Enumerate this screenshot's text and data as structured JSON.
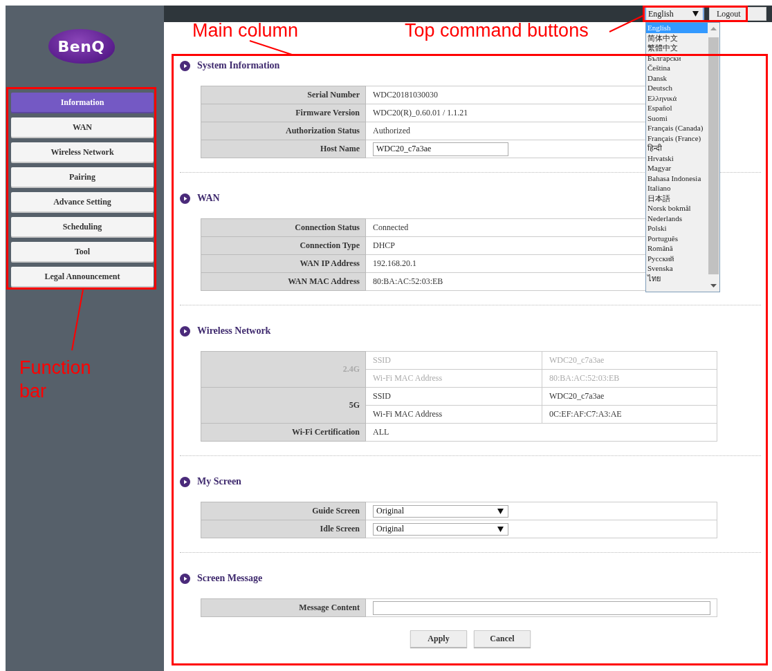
{
  "annotations": [
    {
      "kind": "label",
      "text": "Main column"
    },
    {
      "kind": "label",
      "text": "Top command buttons"
    },
    {
      "kind": "label",
      "text": "Function bar"
    }
  ],
  "logo": "BenQ",
  "sidebar": {
    "items": [
      {
        "label": "Information",
        "selected": true
      },
      {
        "label": "WAN",
        "selected": false
      },
      {
        "label": "Wireless Network",
        "selected": false
      },
      {
        "label": "Pairing",
        "selected": false
      },
      {
        "label": "Advance Setting",
        "selected": false
      },
      {
        "label": "Scheduling",
        "selected": false
      },
      {
        "label": "Tool",
        "selected": false
      },
      {
        "label": "Legal Announcement",
        "selected": false
      }
    ]
  },
  "top_bar": {
    "language": {
      "value": "English",
      "expanded": true,
      "options": [
        {
          "label": "English",
          "selected": true
        },
        {
          "label": "简体中文",
          "selected": false
        },
        {
          "label": "繁體中文",
          "selected": false
        },
        {
          "label": "Български",
          "selected": false
        },
        {
          "label": "Čeština",
          "selected": false
        },
        {
          "label": "Dansk",
          "selected": false
        },
        {
          "label": "Deutsch",
          "selected": false
        },
        {
          "label": "Ελληνικά",
          "selected": false
        },
        {
          "label": "Español",
          "selected": false
        },
        {
          "label": "Suomi",
          "selected": false
        },
        {
          "label": "Français (Canada)",
          "selected": false
        },
        {
          "label": "Français (France)",
          "selected": false
        },
        {
          "label": "हिन्दी",
          "selected": false
        },
        {
          "label": "Hrvatski",
          "selected": false
        },
        {
          "label": "Magyar",
          "selected": false
        },
        {
          "label": "Bahasa Indonesia",
          "selected": false
        },
        {
          "label": "Italiano",
          "selected": false
        },
        {
          "label": "日本語",
          "selected": false
        },
        {
          "label": "Norsk bokmål",
          "selected": false
        },
        {
          "label": "Nederlands",
          "selected": false
        },
        {
          "label": "Polski",
          "selected": false
        },
        {
          "label": "Português",
          "selected": false
        },
        {
          "label": "Română",
          "selected": false
        },
        {
          "label": "Русский",
          "selected": false
        },
        {
          "label": "Svenska",
          "selected": false
        },
        {
          "label": "ไทย",
          "selected": false
        }
      ]
    },
    "logout": "Logout"
  },
  "sections": [
    {
      "title": "System Information",
      "rows": [
        {
          "kind": "text",
          "label": "Serial Number",
          "value": "WDC20181030030"
        },
        {
          "kind": "text",
          "label": "Firmware Version",
          "value": "WDC20(R)_0.60.01 / 1.1.21"
        },
        {
          "kind": "text",
          "label": "Authorization Status",
          "value": "Authorized"
        },
        {
          "kind": "input",
          "label": "Host Name",
          "value": "WDC20_c7a3ae"
        }
      ]
    },
    {
      "title": "WAN",
      "rows": [
        {
          "kind": "text",
          "label": "Connection Status",
          "value": "Connected"
        },
        {
          "kind": "text",
          "label": "Connection Type",
          "value": "DHCP"
        },
        {
          "kind": "text",
          "label": "WAN IP Address",
          "value": "192.168.20.1"
        },
        {
          "kind": "text",
          "label": "WAN MAC Address",
          "value": "80:BA:AC:52:03:EB"
        }
      ]
    },
    {
      "title": "Wireless Network",
      "rows": [
        {
          "kind": "band",
          "label": "2.4G",
          "disabled": true,
          "entries": [
            {
              "name": "SSID",
              "value": "WDC20_c7a3ae"
            },
            {
              "name": "Wi-Fi MAC Address",
              "value": "80:BA:AC:52:03:EB"
            }
          ]
        },
        {
          "kind": "band",
          "label": "5G",
          "disabled": false,
          "entries": [
            {
              "name": "SSID",
              "value": "WDC20_c7a3ae"
            },
            {
              "name": "Wi-Fi MAC Address",
              "value": "0C:EF:AF:C7:A3:AE"
            }
          ]
        },
        {
          "kind": "text",
          "label": "Wi-Fi Certification",
          "value": "ALL"
        }
      ]
    },
    {
      "title": "My Screen",
      "rows": [
        {
          "kind": "select",
          "label": "Guide Screen",
          "value": "Original"
        },
        {
          "kind": "select",
          "label": "Idle Screen",
          "value": "Original"
        }
      ]
    },
    {
      "title": "Screen Message",
      "rows": [
        {
          "kind": "input",
          "label": "Message Content"
        }
      ]
    }
  ],
  "buttons": [
    "Apply",
    "Cancel"
  ]
}
